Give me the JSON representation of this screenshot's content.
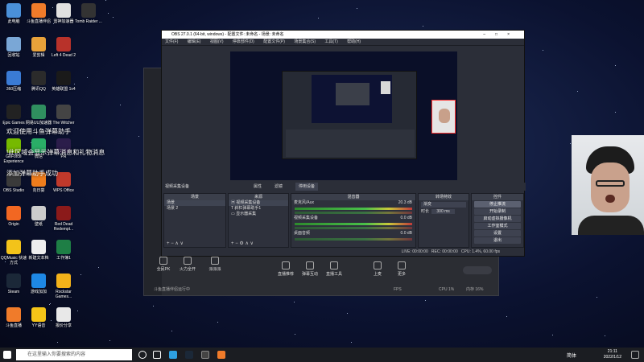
{
  "desktop": {
    "icons": [
      {
        "label": "此电脑",
        "color": "#4a90d9"
      },
      {
        "label": "斗鱼直播伴侣",
        "color": "#f07b2a"
      },
      {
        "label": "雷神加速器",
        "color": "#e0e0e0"
      },
      {
        "label": "Tomb Raider ...",
        "color": "#333333"
      },
      {
        "label": "回收站",
        "color": "#7aa7d6"
      },
      {
        "label": "爱剪辑",
        "color": "#e8a23a"
      },
      {
        "label": "Left 4 Dead 2",
        "color": "#b8322a"
      },
      {
        "label": "360压缩",
        "color": "#3a7bd5"
      },
      {
        "label": "腾讯QQ",
        "color": "#2b2b2b"
      },
      {
        "label": "英雄联盟 1v4",
        "color": "#1a1a1a"
      },
      {
        "label": "Epic Games",
        "color": "#222222"
      },
      {
        "label": "网易UU加速器",
        "color": "#2f8f5f"
      },
      {
        "label": "The Witcher",
        "color": "#444444"
      },
      {
        "label": "GeForce Experience",
        "color": "#76b900"
      },
      {
        "label": "微信",
        "color": "#2aae67"
      },
      {
        "label": "PR",
        "color": "#2b1d4a"
      },
      {
        "label": "OBS Studio",
        "color": "#3a3a3a"
      },
      {
        "label": "向日葵",
        "color": "#ef7d1c"
      },
      {
        "label": "WPS Office",
        "color": "#c0392b"
      },
      {
        "label": "Origin",
        "color": "#f26722"
      },
      {
        "label": "壁纸",
        "color": "#cccccc"
      },
      {
        "label": "Red Dead Redempt...",
        "color": "#8b1a1a"
      },
      {
        "label": "QQMusic 快速方式",
        "color": "#f3c31a"
      },
      {
        "label": "新建文本档",
        "color": "#eeeeee"
      },
      {
        "label": "工作簿1",
        "color": "#1e7e45"
      },
      {
        "label": "Steam",
        "color": "#1b2838"
      },
      {
        "label": "游戏加加",
        "color": "#1e88e5"
      },
      {
        "label": "Rockstar Games...",
        "color": "#f3b21a"
      },
      {
        "label": "斗鱼直播",
        "color": "#f07b2a"
      },
      {
        "label": "YY语音",
        "color": "#f5c518"
      },
      {
        "label": "报价分享",
        "color": "#e8e8e8"
      }
    ]
  },
  "chat_overlay": {
    "lines": [
      "欢迎使用斗鱼弹幕助手",
      "!此区域会显示弹幕消息和礼物消息",
      "添加弹幕助手成功"
    ]
  },
  "douyu": {
    "tools": [
      "全民PK",
      "火力全开",
      "派派派",
      "直播推荐",
      "弹幕互动",
      "直播工具",
      "上麦",
      "更多"
    ],
    "status_text": "斗鱼直播伴侣运行中",
    "status_right": [
      "FPS",
      "CPU 1%",
      "内存 16%"
    ]
  },
  "obs": {
    "title": "OBS 27.0.1 (64-bit, windows) - 配置文件: 未命名 - 场景: 未命名",
    "menu": [
      "文件(F)",
      "编辑(E)",
      "视图(V)",
      "停靠部件(D)",
      "配置文件(P)",
      "场景集合(S)",
      "工具(T)",
      "帮助(H)"
    ],
    "source_bar": {
      "source": "视频采集设备",
      "properties": "属性",
      "filters": "滤镜",
      "deactivate": "停用设备"
    },
    "scenes": {
      "title": "场景",
      "items": [
        "场景",
        "场景 2"
      ]
    },
    "sources": {
      "title": "来源",
      "items": [
        "视频采集设备",
        "斜杠弹幕助手1",
        "显示器采集"
      ]
    },
    "mixer": {
      "title": "混音器",
      "channels": [
        {
          "name": "麦克风/Aux",
          "level": "20.3 dB"
        },
        {
          "name": "视频采集设备",
          "level": "0.0 dB"
        },
        {
          "name": "桌面音频",
          "level": "0.0 dB"
        }
      ]
    },
    "transitions": {
      "title": "转场特效",
      "mode": "渐变",
      "duration_label": "时长",
      "duration": "300 ms"
    },
    "controls": {
      "title": "控件",
      "buttons": [
        "停止推流",
        "开始录制",
        "启动虚拟摄像机",
        "工作室模式",
        "设置",
        "退出"
      ]
    },
    "status": {
      "live": "LIVE: 00:00:00",
      "rec": "REC: 00:00:00",
      "cpu": "CPU: 1.4%, 60.00 fps"
    }
  },
  "taskbar": {
    "search_placeholder": "在这里输入你要搜索的内容",
    "time": "21:11",
    "date": "2022/1/12",
    "ime": "简体"
  },
  "colors": {
    "desktop_bg": "#0b1230",
    "obs_panel": "#2b2e38",
    "douyu_panel": "#2b2d33",
    "meter_green": "#49c049",
    "face_box": "#ff3333"
  }
}
